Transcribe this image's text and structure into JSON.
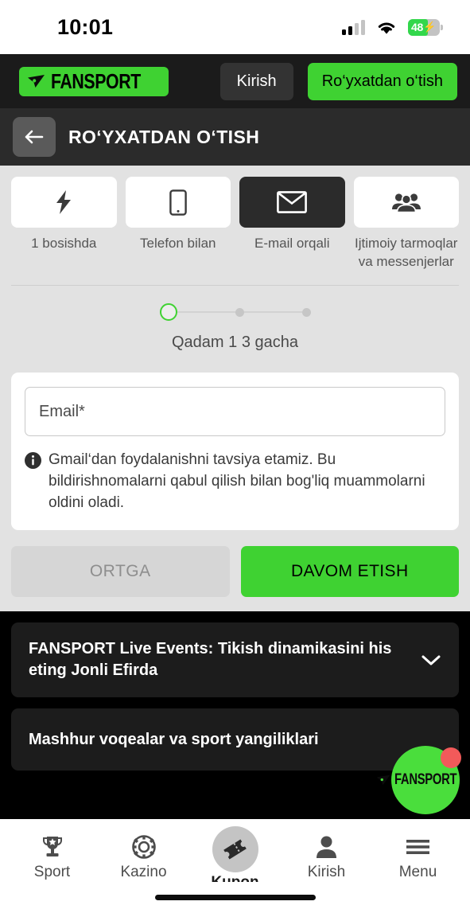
{
  "status_bar": {
    "time": "10:01",
    "battery_percent": "48",
    "battery_charging": true,
    "wifi": "wifi-icon",
    "signal_bars_filled": 2
  },
  "header": {
    "logo_text": "FANSPORT",
    "login_label": "Kirish",
    "register_label": "Ro‘yxatdan o‘tish"
  },
  "page": {
    "title": "RO‘YXATDAN O‘TISH",
    "back_icon": "arrow-left-icon"
  },
  "method_tabs": [
    {
      "label": "1 bosishda",
      "icon": "lightning-bolt-icon",
      "active": false
    },
    {
      "label": "Telefon bilan",
      "icon": "phone-icon",
      "active": false
    },
    {
      "label": "E-mail orqali",
      "icon": "envelope-icon",
      "active": true
    },
    {
      "label": "Ijtimoiy tarmoqlar va messenjerlar",
      "icon": "people-group-icon",
      "active": false
    }
  ],
  "stepper": {
    "total_steps": 3,
    "current_step": 1,
    "caption": "Qadam 1 3 gacha"
  },
  "form": {
    "email_placeholder": "Email*",
    "email_value": "",
    "hint_icon": "info-icon",
    "hint_text": "Gmail‘dan foydalanishni tavsiya etamiz. Bu bildirishnomalarni qabul qilish bilan bog'liq muammolarni oldini oladi."
  },
  "actions": {
    "back_label": "ORTGA",
    "back_disabled": true,
    "next_label": "DAVOM ETISH"
  },
  "accordions": [
    {
      "title": "FANSPORT Live Events: Tikish dinamikasini his eting Jonli Efirda",
      "icon": "chevron-down-icon",
      "expanded": false
    },
    {
      "title": "Mashhur voqealar va sport yangiliklari",
      "icon": "chevron-down-icon",
      "expanded": false
    }
  ],
  "fab": {
    "text": "FANSPORT",
    "icon": "fansport-mark-icon",
    "badge": true,
    "badge_color": "#f25a5a"
  },
  "bottom_nav": [
    {
      "label": "Sport",
      "icon": "trophy-icon",
      "active": false
    },
    {
      "label": "Kazino",
      "icon": "casino-chip-icon",
      "active": false
    },
    {
      "label": "Kupon",
      "icon": "ticket-icon",
      "active": true
    },
    {
      "label": "Kirish",
      "icon": "person-icon",
      "active": false
    },
    {
      "label": "Menu",
      "icon": "hamburger-menu-icon",
      "active": false
    }
  ],
  "colors": {
    "brand_green": "#3fd232",
    "fab_green": "#4ade3c",
    "dark_header": "#1b1b1b",
    "page_bar": "#2b2b2b",
    "page_bg": "#e2e2e2",
    "badge_red": "#f25a5a",
    "battery_green": "#32d74b"
  }
}
